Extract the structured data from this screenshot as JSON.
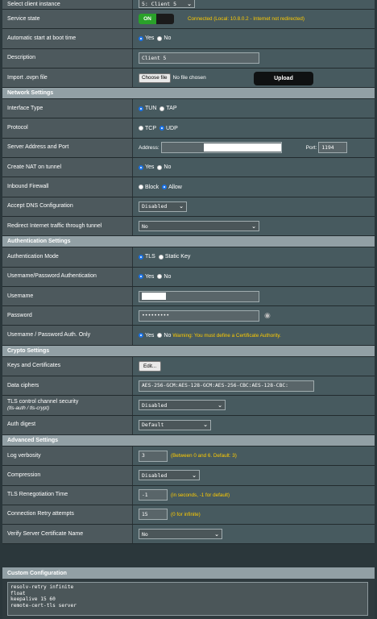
{
  "rows1": {
    "select_client": {
      "label": "Select client instance",
      "value": "5: Client 5"
    },
    "service_state": {
      "label": "Service state",
      "toggle": "ON",
      "status": "Connected (Local: 10.8.0.2 - Internet not redirected)"
    },
    "auto_start": {
      "label": "Automatic start at boot time",
      "yes": "Yes",
      "no": "No"
    },
    "description": {
      "label": "Description",
      "value": "Client 5"
    },
    "import": {
      "label": "Import .ovpn file",
      "choose": "Choose file",
      "no_file": "No file chosen",
      "upload": "Upload"
    }
  },
  "network": {
    "title": "Network Settings",
    "interface": {
      "label": "Interface Type",
      "opt1": "TUN",
      "opt2": "TAP"
    },
    "protocol": {
      "label": "Protocol",
      "opt1": "TCP",
      "opt2": "UDP"
    },
    "server": {
      "label": "Server Address and Port",
      "address_label": "Address:",
      "address": "",
      "port_label": "Port:",
      "port": "1194"
    },
    "nat": {
      "label": "Create NAT on tunnel",
      "yes": "Yes",
      "no": "No"
    },
    "firewall": {
      "label": "Inbound Firewall",
      "opt1": "Block",
      "opt2": "Allow"
    },
    "dns": {
      "label": "Accept DNS Configuration",
      "value": "Disabled"
    },
    "redirect": {
      "label": "Redirect Internet traffic through tunnel",
      "value": "No"
    }
  },
  "auth": {
    "title": "Authentication Settings",
    "mode": {
      "label": "Authentication Mode",
      "opt1": "TLS",
      "opt2": "Static Key"
    },
    "userpass": {
      "label": "Username/Password Authentication",
      "yes": "Yes",
      "no": "No"
    },
    "username": {
      "label": "Username",
      "value": ""
    },
    "password": {
      "label": "Password",
      "value": "•••••••••"
    },
    "only": {
      "label": "Username / Password Auth. Only",
      "yes": "Yes",
      "no": "No",
      "warning": "Warning: You must define a Certificate Authority."
    }
  },
  "crypto": {
    "title": "Crypto Settings",
    "keys": {
      "label": "Keys and Certificates",
      "button": "Edit..."
    },
    "ciphers": {
      "label": "Data ciphers",
      "value": "AES-256-GCM:AES-128-GCM:AES-256-CBC:AES-128-CBC:"
    },
    "tls_sec": {
      "label": "TLS control channel security",
      "sublabel": "(tls-auth / tls-crypt)",
      "value": "Disabled"
    },
    "digest": {
      "label": "Auth digest",
      "value": "Default"
    }
  },
  "advanced": {
    "title": "Advanced Settings",
    "verbosity": {
      "label": "Log verbosity",
      "value": "3",
      "hint": "(Between 0 and 6. Default: 3)"
    },
    "compression": {
      "label": "Compression",
      "value": "Disabled"
    },
    "reneg": {
      "label": "TLS Renegotiation Time",
      "value": "-1",
      "hint": "(in seconds, -1 for default)"
    },
    "retry": {
      "label": "Connection Retry attempts",
      "value": "15",
      "hint": "(0 for infinite)"
    },
    "verify": {
      "label": "Verify Server Certificate Name",
      "value": "No"
    }
  },
  "custom": {
    "title": "Custom Configuration",
    "text": "resolv-retry infinite\nfloat\nkeepalive 15 60\nremote-cert-tls server"
  }
}
